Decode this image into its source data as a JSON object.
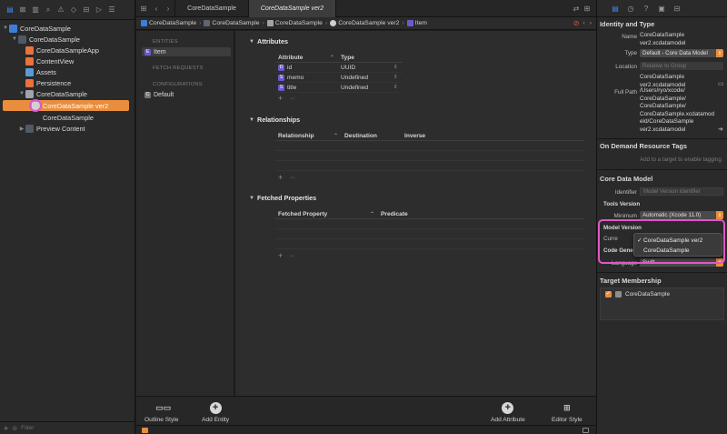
{
  "navigator": {
    "tree": [
      {
        "label": "CoreDataSample",
        "icon": "project-icon"
      },
      {
        "label": "CoreDataSample",
        "icon": "folder-icon"
      },
      {
        "label": "CoreDataSampleApp",
        "icon": "swift-file-icon"
      },
      {
        "label": "ContentView",
        "icon": "swift-file-icon"
      },
      {
        "label": "Assets",
        "icon": "asset-catalog-icon"
      },
      {
        "label": "Persistence",
        "icon": "swift-file-icon"
      },
      {
        "label": "CoreDataSample",
        "icon": "data-model-group-icon"
      },
      {
        "label": "CoreDataSample ver2",
        "icon": "data-model-icon"
      },
      {
        "label": "CoreDataSample",
        "icon": "data-model-file-icon"
      },
      {
        "label": "Preview Content",
        "icon": "folder-icon"
      }
    ],
    "filter_placeholder": "Filter"
  },
  "tabs": [
    {
      "label": "CoreDataSample"
    },
    {
      "label": "CoreDataSample ver2"
    }
  ],
  "jumpbar": [
    "CoreDataSample",
    "CoreDataSample",
    "CoreDataSample",
    "CoreDataSample ver2",
    "Item"
  ],
  "outline": {
    "entities_header": "ENTITIES",
    "entity": "Item",
    "fetch_requests_header": "FETCH REQUESTS",
    "configurations_header": "CONFIGURATIONS",
    "configuration": "Default"
  },
  "editor": {
    "attributes_title": "Attributes",
    "attributes_headers": [
      "Attribute",
      "Type"
    ],
    "attributes": [
      {
        "badge": "D",
        "name": "id",
        "type": "UUID"
      },
      {
        "badge": "S",
        "name": "memo",
        "type": "Undefined"
      },
      {
        "badge": "S",
        "name": "title",
        "type": "Undefined"
      }
    ],
    "relationships_title": "Relationships",
    "relationships_headers": [
      "Relationship",
      "Destination",
      "Inverse"
    ],
    "fetched_title": "Fetched Properties",
    "fetched_headers": [
      "Fetched Property",
      "Predicate"
    ],
    "plus": "+",
    "minus": "−"
  },
  "bottom_bar": {
    "outline_style": "Outline Style",
    "add_entity": "Add Entity",
    "add_attribute": "Add Attribute",
    "editor_style": "Editor Style"
  },
  "inspector": {
    "identity_title": "Identity and Type",
    "name_label": "Name",
    "name_value": "CoreDataSample ver2.xcdatamodel",
    "type_label": "Type",
    "type_value": "Default - Core Data Model",
    "location_label": "Location",
    "location_value": "Relative to Group",
    "location_file": "CoreDataSample ver2.xcdatamodel",
    "full_path_label": "Full Path",
    "full_path_value": "/Users/ryo/xcode/ CoreDataSample/ CoreDataSample/ CoreDataSample.xcdatamod eld/CoreDataSample ver2.xcdatamodel",
    "on_demand_title": "On Demand Resource Tags",
    "on_demand_placeholder": "Add to a target to enable tagging",
    "core_data_title": "Core Data Model",
    "identifier_label": "Identifier",
    "identifier_placeholder": "Model Version Identifier",
    "tools_version_label": "Tools Version",
    "minimum_label": "Minimum",
    "minimum_value": "Automatic (Xcode 11.0)",
    "model_version_label": "Model Version",
    "current_label": "Curre",
    "code_gen_label": "Code Gener",
    "language_label": "Language",
    "language_value": "Swift",
    "target_title": "Target Membership",
    "target_value": "CoreDataSample"
  },
  "popup_menu": {
    "items": [
      {
        "label": "CoreDataSample ver2",
        "checked": "✓"
      },
      {
        "label": "CoreDataSample",
        "checked": ""
      }
    ]
  },
  "colors": {
    "accent": "#e98e3c",
    "highlight": "#e056c8",
    "selection_blue": "#3b8cf7"
  }
}
